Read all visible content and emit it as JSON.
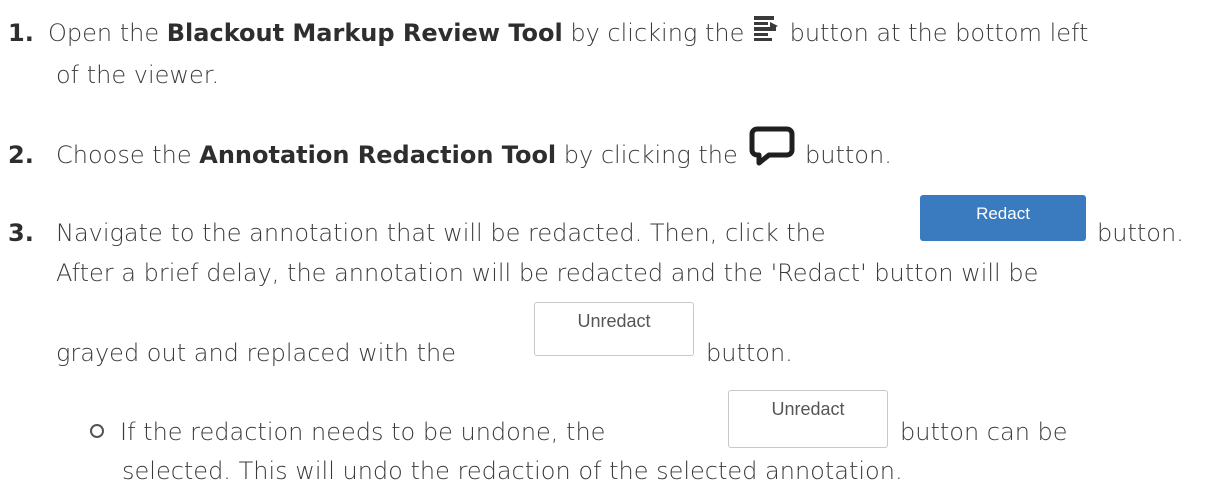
{
  "steps": [
    {
      "number": "1.",
      "text_a": "Open the ",
      "bold": "Blackout Markup Review Tool",
      "text_b": " by clicking the ",
      "text_c": " button at the bottom left",
      "text_d": "of the viewer."
    },
    {
      "number": "2.",
      "text_a": "Choose the ",
      "bold": "Annotation Redaction Tool",
      "text_b": " by clicking the ",
      "text_c": " button."
    },
    {
      "number": "3.",
      "text_a": "Navigate to the annotation that will be redacted. Then, click the",
      "text_b": "button.",
      "text_c": "After a brief delay, the annotation will be redacted and the 'Redact' button will be",
      "text_d": "grayed out and replaced with the",
      "text_e": "button."
    }
  ],
  "sub_bullet": {
    "text_a": "If the redaction needs to be undone, the",
    "text_b": "button can be",
    "text_c": "selected. This will undo the redaction of the selected annotation."
  },
  "buttons": {
    "redact_label": "Redact",
    "unredact_label": "Unredact"
  },
  "icons": {
    "markup_review": "markup-review-icon",
    "annotation_redaction": "speech-bubble-icon"
  },
  "colors": {
    "redact_button": "#3a7bc0"
  }
}
